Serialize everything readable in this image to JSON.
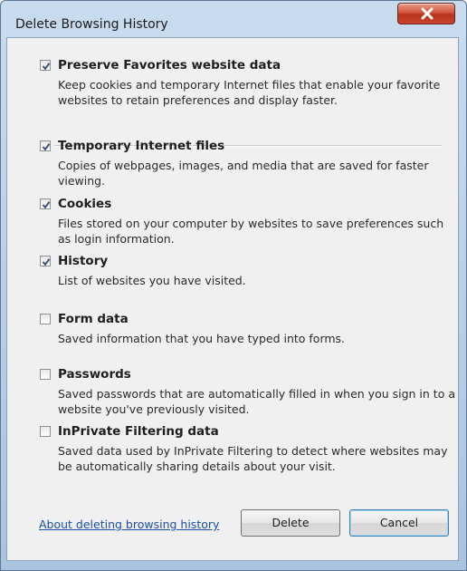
{
  "window": {
    "title": "Delete Browsing History"
  },
  "options": [
    {
      "title": "Preserve Favorites website data",
      "checked": true,
      "description": "Keep cookies and temporary Internet files that enable your favorite websites to retain preferences and display faster."
    },
    {
      "title": "Temporary Internet files",
      "checked": true,
      "description": "Copies of webpages, images, and media that are saved for faster viewing."
    },
    {
      "title": "Cookies",
      "checked": true,
      "description": "Files stored on your computer by websites to save preferences such as login information."
    },
    {
      "title": "History",
      "checked": true,
      "description": "List of websites you have visited."
    },
    {
      "title": "Form data",
      "checked": false,
      "description": "Saved information that you have typed into forms."
    },
    {
      "title": "Passwords",
      "checked": false,
      "description": "Saved passwords that are automatically filled in when you sign in to a website you've previously visited."
    },
    {
      "title": "InPrivate Filtering data",
      "checked": false,
      "description": "Saved data used by InPrivate Filtering to detect where websites may be automatically sharing details about your visit."
    }
  ],
  "footer": {
    "link_text": "About deleting browsing history",
    "delete_label": "Delete",
    "cancel_label": "Cancel"
  },
  "colors": {
    "link": "#1a4fa8",
    "close_button": "#c9452d",
    "client_background": "#f0f0f0"
  }
}
